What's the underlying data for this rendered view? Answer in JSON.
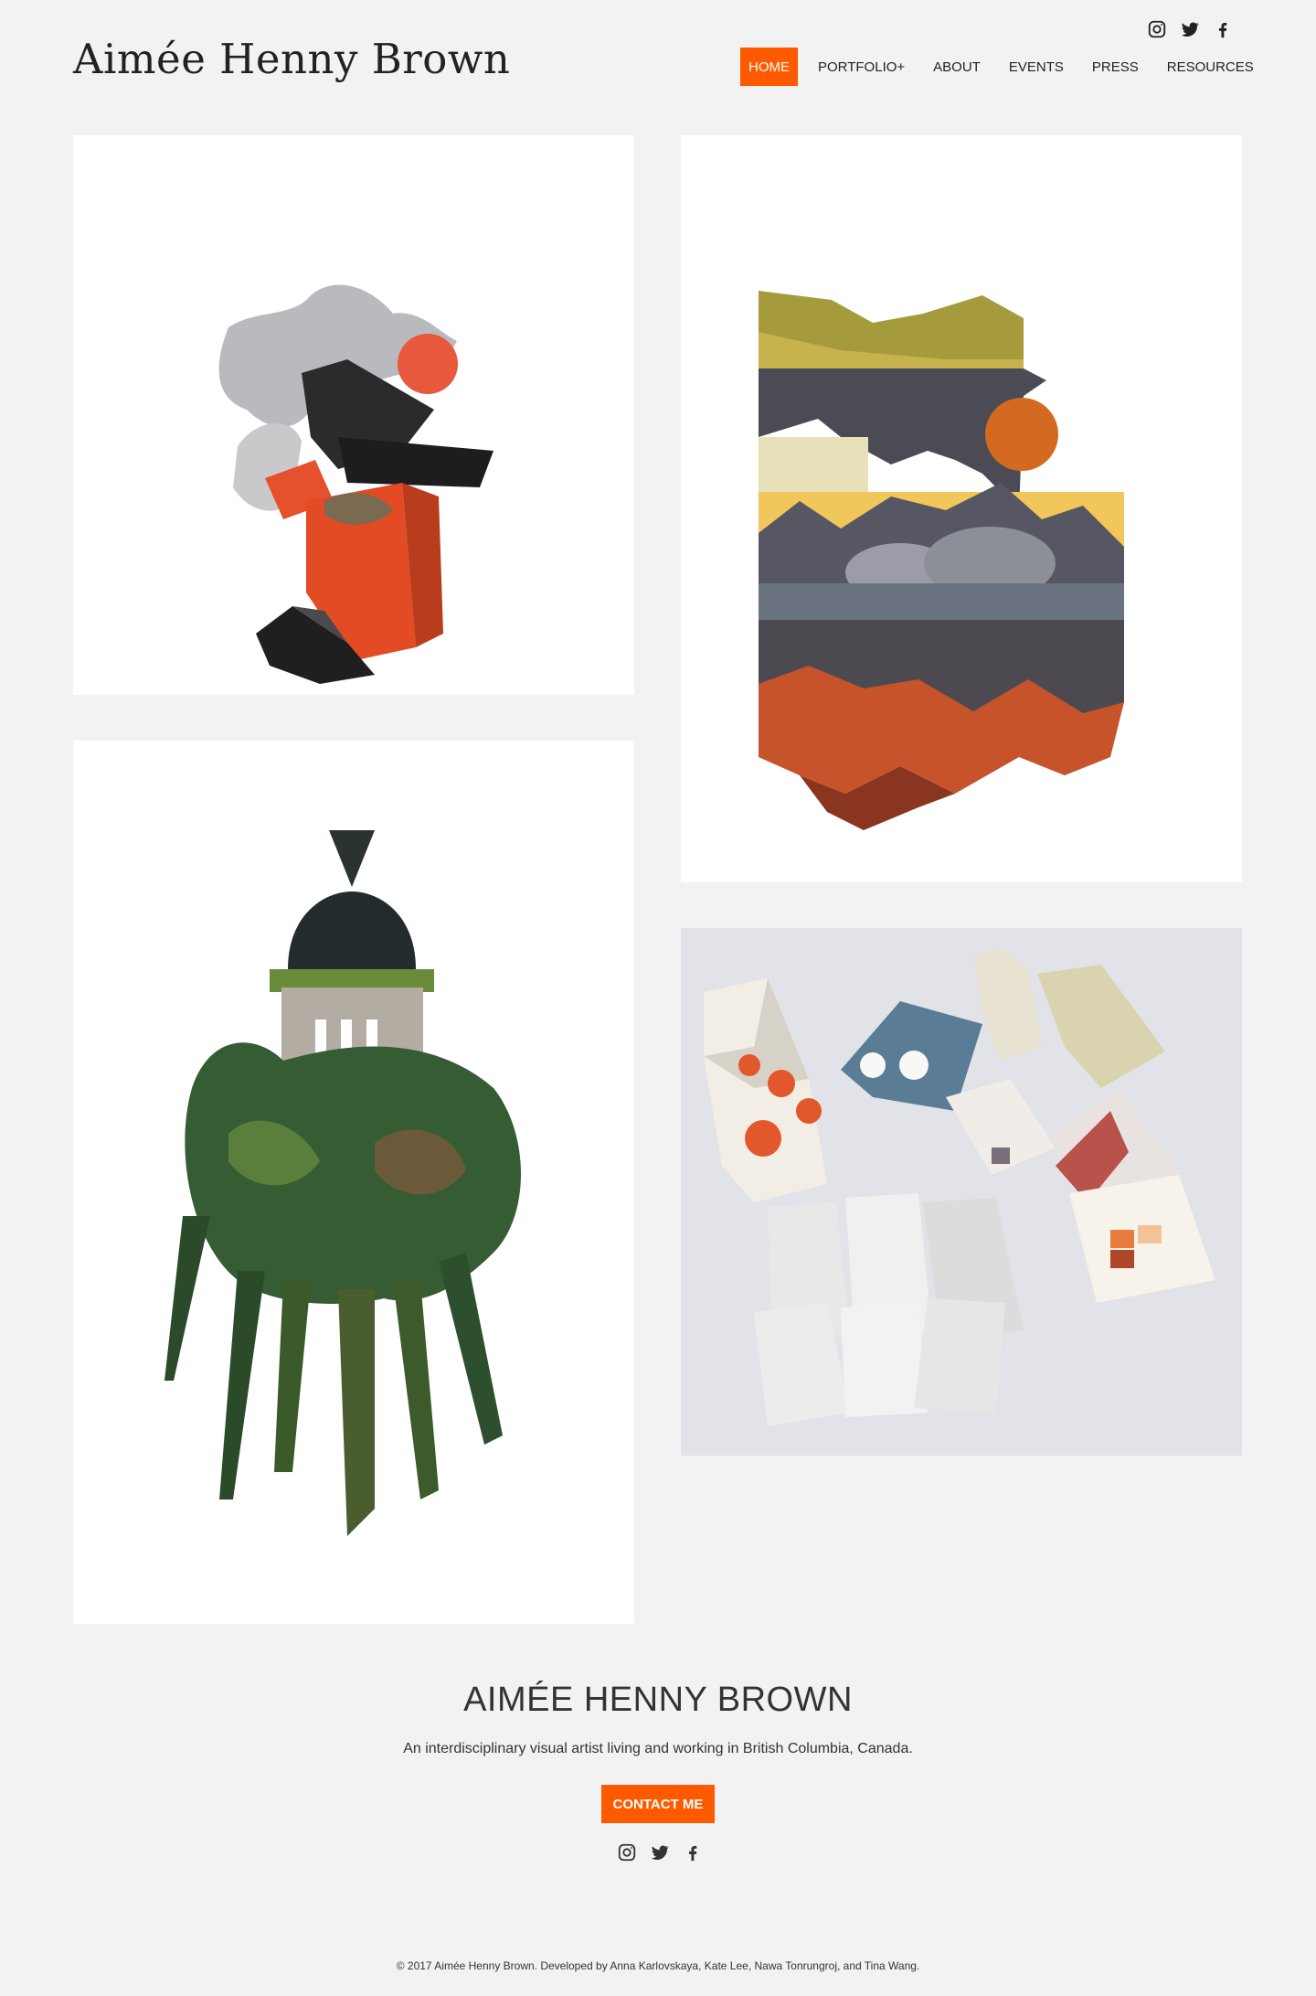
{
  "header": {
    "site_title": "Aimée Henny Brown",
    "nav": [
      {
        "label": "HOME",
        "active": true
      },
      {
        "label": "PORTFOLIO+"
      },
      {
        "label": "ABOUT"
      },
      {
        "label": "EVENTS"
      },
      {
        "label": "PRESS"
      },
      {
        "label": "RESOURCES"
      }
    ],
    "social_icons": [
      "instagram-icon",
      "twitter-icon",
      "facebook-icon"
    ]
  },
  "gallery": [
    {
      "name": "collage-architectural-mineral"
    },
    {
      "name": "collage-mountain-domes"
    },
    {
      "name": "collage-dome-botanical"
    },
    {
      "name": "artist-books-portable-lighthouse-library"
    }
  ],
  "footer": {
    "title": "AIMÉE HENNY BROWN",
    "tagline": "An interdisciplinary visual artist living and working in British Columbia, Canada.",
    "contact_label": "CONTACT ME",
    "copyright": "© 2017 Aimée Henny Brown. Developed by Anna Karlovskaya, Kate Lee, Nawa Tonrungroj, and Tina Wang."
  },
  "colors": {
    "accent": "#ff5a00",
    "background": "#f2f2f2",
    "text": "#222222"
  }
}
